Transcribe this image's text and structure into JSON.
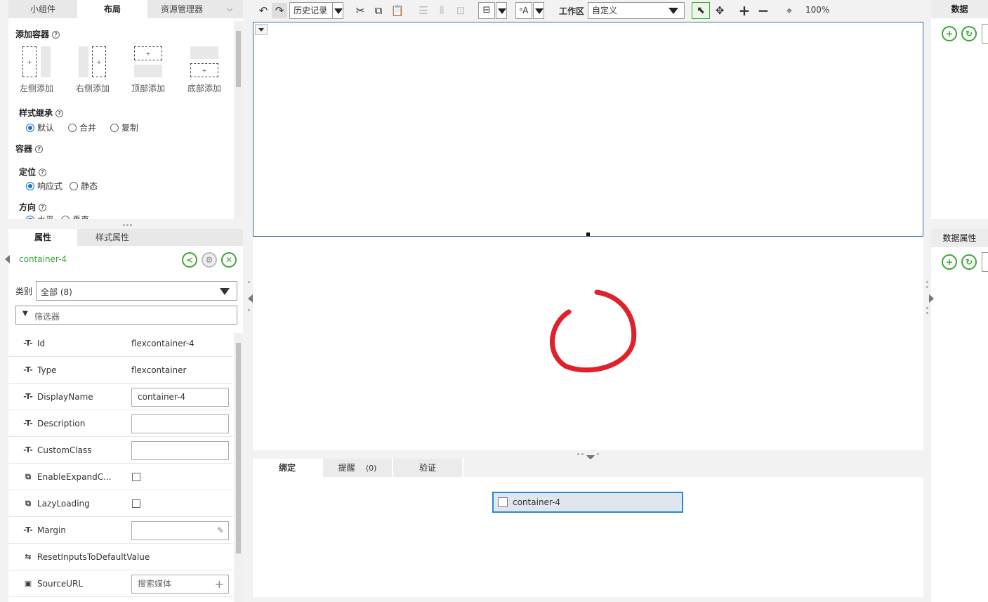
{
  "left_tabs": [
    "小组件",
    "布局",
    "资源管理器"
  ],
  "add_container": {
    "title": "添加容器",
    "items": [
      {
        "label": "左侧添加",
        "mark": "+"
      },
      {
        "label": "右侧添加",
        "mark": "+"
      },
      {
        "label": "顶部添加",
        "mark": "+"
      },
      {
        "label": "底部添加",
        "mark": "+"
      }
    ]
  },
  "style_inherit": {
    "title": "样式继承",
    "options": [
      "默认",
      "合并",
      "复制"
    ],
    "selected": "默认"
  },
  "container_section": "容器",
  "positioning": {
    "title": "定位",
    "options": [
      "响应式",
      "静态"
    ],
    "selected": "响应式"
  },
  "direction": {
    "title": "方向",
    "options": [
      "水平",
      "垂直"
    ],
    "selected": "水平"
  },
  "props_tabs": [
    "属性",
    "样式属性"
  ],
  "widget_name": "container-4",
  "category": {
    "label": "类别",
    "value": "全部 (8)"
  },
  "filter_placeholder": "筛选器",
  "properties": [
    {
      "name": "Id",
      "kind": "text",
      "value": "flexcontainer-4",
      "icon": "text-property-icon"
    },
    {
      "name": "Type",
      "kind": "text",
      "value": "flexcontainer",
      "icon": "text-property-icon"
    },
    {
      "name": "DisplayName",
      "kind": "input",
      "value": "container-4",
      "icon": "text-property-icon"
    },
    {
      "name": "Description",
      "kind": "input",
      "value": "",
      "icon": "text-property-icon"
    },
    {
      "name": "CustomClass",
      "kind": "input",
      "value": "",
      "icon": "text-property-icon"
    },
    {
      "name": "EnableExpandC...",
      "kind": "check",
      "value": "",
      "icon": "boolean-property-icon"
    },
    {
      "name": "LazyLoading",
      "kind": "check",
      "value": "",
      "icon": "boolean-property-icon"
    },
    {
      "name": "Margin",
      "kind": "input",
      "value": "",
      "icon": "text-property-icon"
    },
    {
      "name": "ResetInputsToDefaultValue",
      "kind": "service",
      "value": "",
      "icon": "service-icon"
    },
    {
      "name": "SourceURL",
      "kind": "input",
      "value": "",
      "placeholder": "搜索媒体",
      "icon": "media-icon"
    }
  ],
  "toolbar": {
    "history": "历史记录",
    "workspace_label": "工作区",
    "workspace_value": "自定义",
    "zoom": "100%",
    "lang_icon_text": "ᵃA"
  },
  "binding_tabs": [
    {
      "label": "绑定"
    },
    {
      "label": "提醒",
      "count": "(0)"
    },
    {
      "label": "验证"
    }
  ],
  "binding_item": "container-4",
  "right_top_title": "数据",
  "right_bottom_title": "数据属性",
  "colors": {
    "accent_green": "#3aa635",
    "selection_blue": "#3b6ea5",
    "annotation_red": "#e0202a"
  }
}
